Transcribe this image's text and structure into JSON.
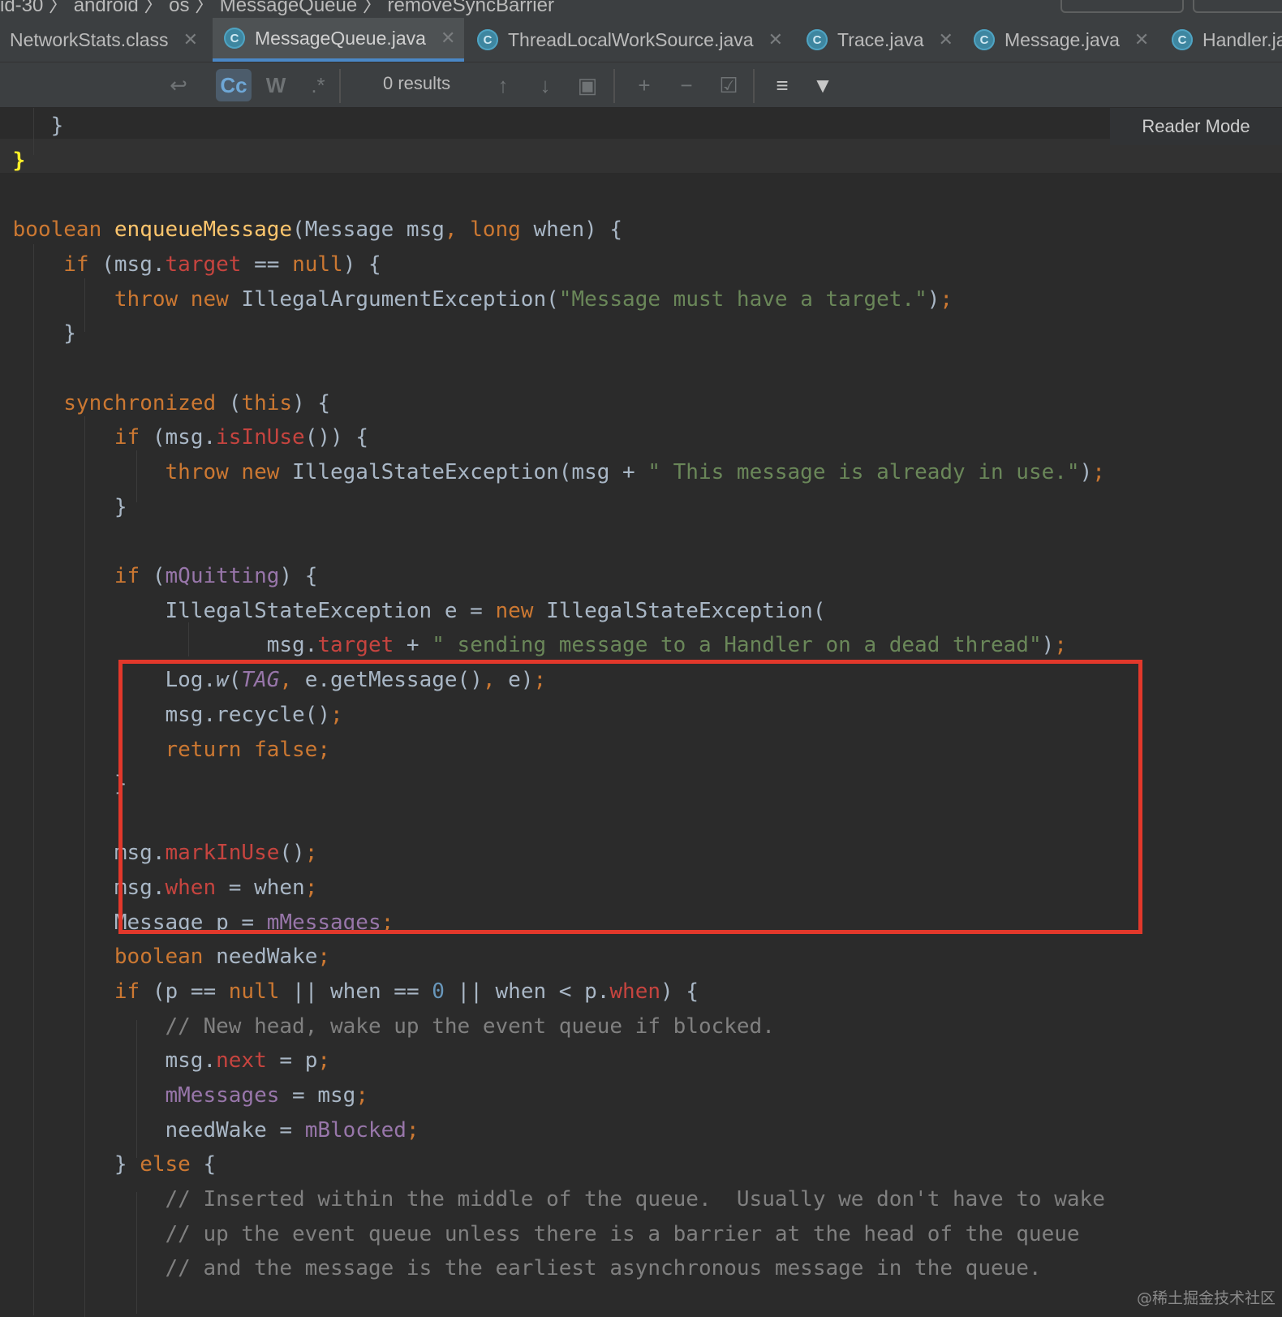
{
  "breadcrumb": {
    "text": "id-30  〉  android  〉  os  〉  MessageQueue  〉  removeSyncBarrier"
  },
  "tabs": [
    {
      "label": "NetworkStats.class",
      "icon": "class-file-icon",
      "active": false
    },
    {
      "label": "MessageQueue.java",
      "icon": "java-class-icon",
      "active": true
    },
    {
      "label": "ThreadLocalWorkSource.java",
      "icon": "java-class-icon",
      "active": false
    },
    {
      "label": "Trace.java",
      "icon": "java-class-icon",
      "active": false
    },
    {
      "label": "Message.java",
      "icon": "java-class-icon",
      "active": false
    },
    {
      "label": "Handler.ja",
      "icon": "java-class-icon",
      "active": false
    }
  ],
  "find": {
    "results_label": "0 results",
    "match_case_label": "Cc",
    "words_label": "W",
    "regex_label": ".*"
  },
  "editor": {
    "reader_mode_label": "Reader Mode"
  },
  "colors": {
    "keyword": "#cc7832",
    "method": "#ffc66d",
    "string": "#6a8759",
    "field": "#c6443f",
    "member": "#9876aa",
    "number": "#6897bb",
    "comment": "#808080",
    "highlight_border": "#e2382b"
  },
  "watermark": "@稀土掘金技术社区"
}
